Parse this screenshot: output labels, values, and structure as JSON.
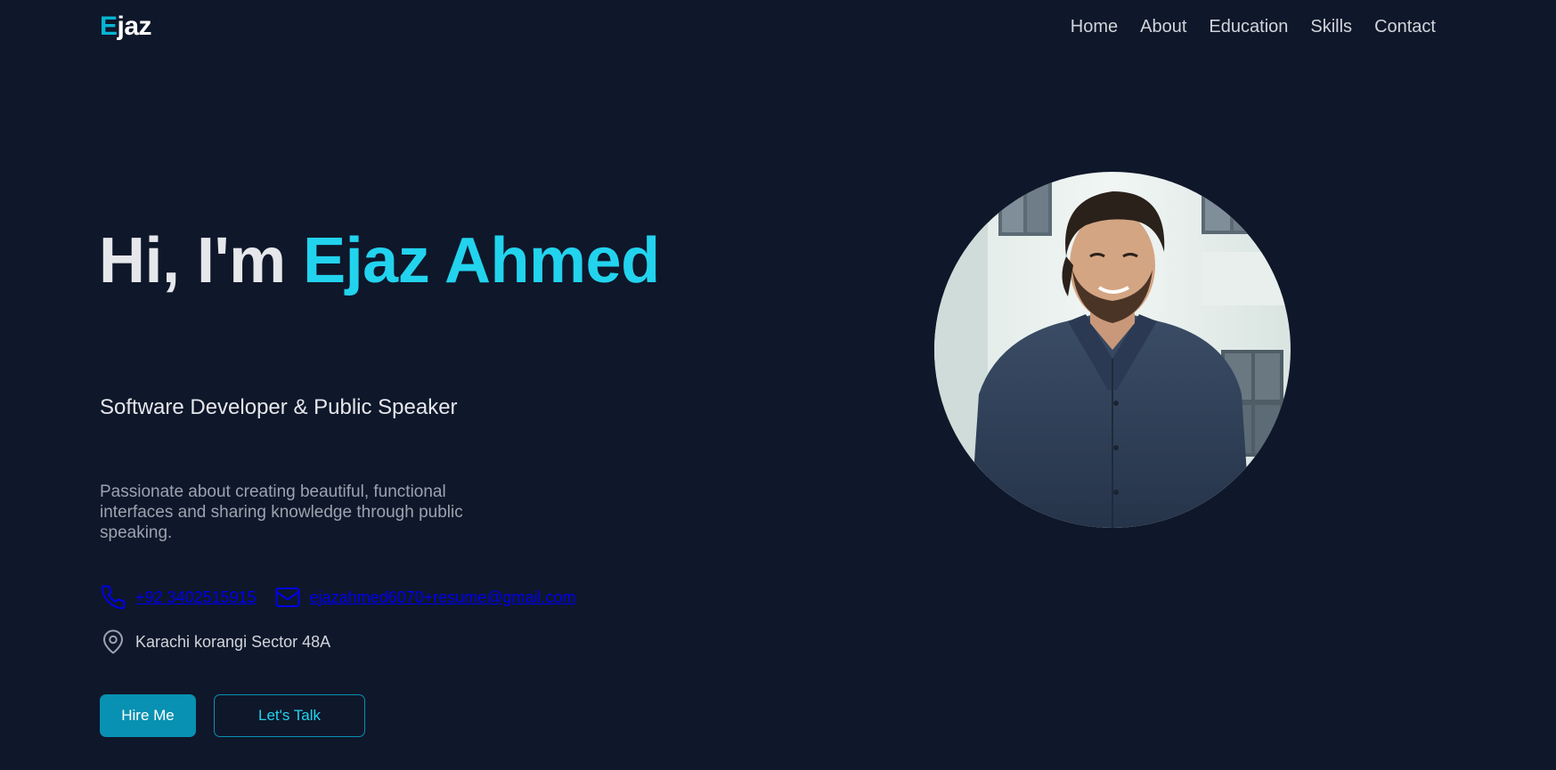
{
  "nav": {
    "logo_first": "E",
    "logo_rest": "jaz",
    "links": [
      "Home",
      "About",
      "Education",
      "Skills",
      "Contact"
    ]
  },
  "hero": {
    "greeting": "Hi, I'm ",
    "name": "Ejaz Ahmed",
    "subtitle": "Software Developer & Public Speaker",
    "description": "Passionate about creating beautiful, functional interfaces and sharing knowledge through public speaking.",
    "phone": "+92 3402515915",
    "email": "ejazahmed6070+resume@gmail.com",
    "location": "Karachi korangi Sector 48A",
    "hire_button": "Hire Me",
    "talk_button": "Let's Talk"
  },
  "icons": {
    "phone": "phone-icon",
    "email": "mail-icon",
    "location": "map-pin-icon"
  },
  "colors": {
    "background": "#0f172a",
    "accent": "#22d3ee",
    "button": "#0891b2",
    "link": "#0000ee"
  }
}
